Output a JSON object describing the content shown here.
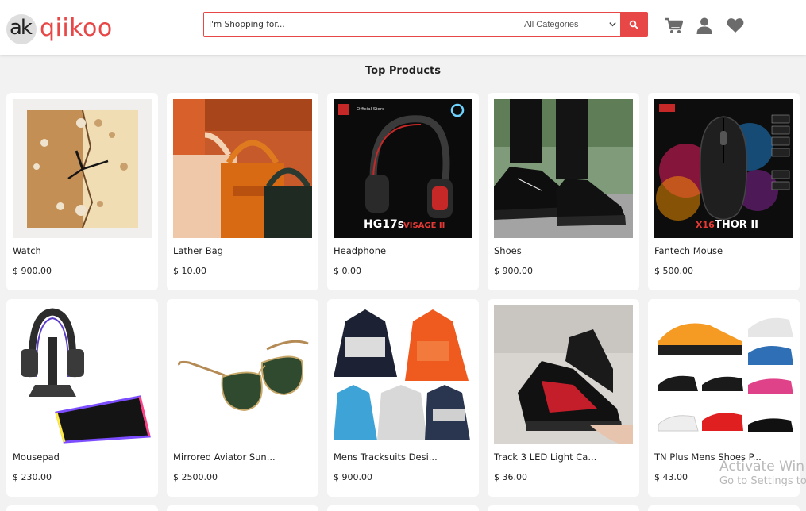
{
  "header": {
    "logo_mark": "ak",
    "logo_text": "qiikoo",
    "search_placeholder": "I'm Shopping for...",
    "category_selected": "All Categories",
    "icons": [
      "search-icon",
      "cart-icon",
      "user-icon",
      "heart-icon"
    ]
  },
  "section": {
    "title": "Top Products"
  },
  "products": [
    {
      "name": "Watch",
      "price": "$ 900.00"
    },
    {
      "name": "Lather Bag",
      "price": "$ 10.00"
    },
    {
      "name": "Headphone",
      "price": "$ 0.00"
    },
    {
      "name": "Shoes",
      "price": "$ 900.00"
    },
    {
      "name": "Fantech Mouse",
      "price": "$ 500.00"
    },
    {
      "name": "Mousepad",
      "price": "$ 230.00"
    },
    {
      "name": "Mirrored Aviator Sun...",
      "price": "$ 2500.00"
    },
    {
      "name": "Mens Tracksuits Desi...",
      "price": "$ 900.00"
    },
    {
      "name": "Track 3 LED Light Ca...",
      "price": "$ 36.00"
    },
    {
      "name": "TN Plus Mens Shoes P...",
      "price": "$ 43.00"
    }
  ],
  "product_image_text": {
    "headphone_store": "Official Store",
    "headphone_model": "HG17s",
    "headphone_sub": "VISAGE II",
    "mouse_model": "X16",
    "mouse_sub": "THOR II"
  },
  "watermark": {
    "line1": "Activate Win",
    "line2": "Go to Settings to"
  },
  "colors": {
    "accent": "#e84747",
    "background": "#f2f2f2",
    "card": "#ffffff",
    "icon_gray": "#6b6b6b"
  }
}
